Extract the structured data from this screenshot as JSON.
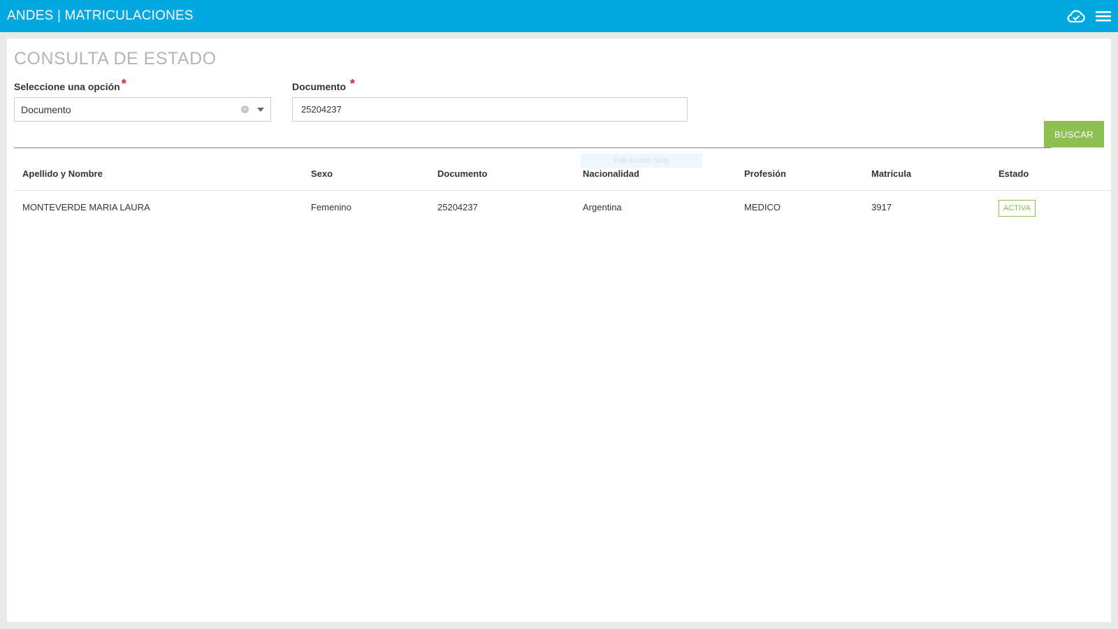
{
  "header": {
    "title": "ANDES | MATRICULACIONES",
    "icons": [
      "cloud-check-icon",
      "hamburger-menu-icon"
    ],
    "color": "#00a8e0"
  },
  "page": {
    "title": "CONSULTA DE ESTADO"
  },
  "form": {
    "option_label": "Seleccione una opción",
    "option_required": "*",
    "option_value": "Documento",
    "document_label": "Documento",
    "document_required": "*",
    "document_value": "25204237",
    "search_button": "BUSCAR",
    "button_color": "#8cc152"
  },
  "overlay": {
    "snip_text": "Full-screen Snip"
  },
  "table": {
    "columns": [
      "Apellido y Nombre",
      "Sexo",
      "Documento",
      "Nacionalidad",
      "Profesión",
      "Matrícula",
      "Estado"
    ],
    "rows": [
      {
        "nombre": "MONTEVERDE MARIA LAURA",
        "sexo": "Femenino",
        "documento": "25204237",
        "nacionalidad": "Argentina",
        "profesion": "MEDICO",
        "matricula": "3917",
        "estado": "ACTIVA"
      }
    ]
  }
}
